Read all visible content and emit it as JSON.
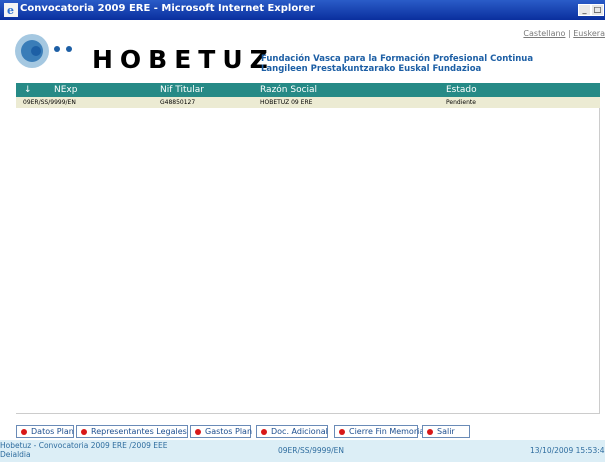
{
  "window": {
    "title": "Convocatoria 2009 ERE - Microsoft Internet Explorer",
    "minimize_glyph": "_",
    "maximize_glyph": "□",
    "close_glyph": "x"
  },
  "language": {
    "castellano": "Castellano",
    "separator": "|",
    "euskera": "Euskera"
  },
  "brand": {
    "name": "HOBETUZ",
    "foundation_es": "Fundación Vasca para la Formación Profesional Continua",
    "foundation_eu": "Langileen Prestakuntzarako Euskal Fundazioa",
    "accent_color": "#1d5fa5"
  },
  "grid": {
    "header_color": "#268a86",
    "sort_glyph": "↓",
    "columns": [
      "NExp",
      "Nif Titular",
      "Razón Social",
      "Estado"
    ],
    "rows": [
      {
        "nexp": "09ER/SS/9999/EN",
        "nif": "G48850127",
        "razon": "HOBETUZ 09 ERE",
        "estado": "Pendiente"
      }
    ]
  },
  "buttons": [
    "Datos Plan",
    "Representantes Legales",
    "Gastos Plan",
    "Doc. Adicional",
    "Cierre Fin Memoria",
    "Salir"
  ],
  "status": {
    "left_line1": "Hobetuz - Convocatoria 2009 ERE /2009 EEE",
    "left_line2": "Deialdia",
    "center": "09ER/SS/9999/EN",
    "datetime": "13/10/2009 15:53:4"
  }
}
